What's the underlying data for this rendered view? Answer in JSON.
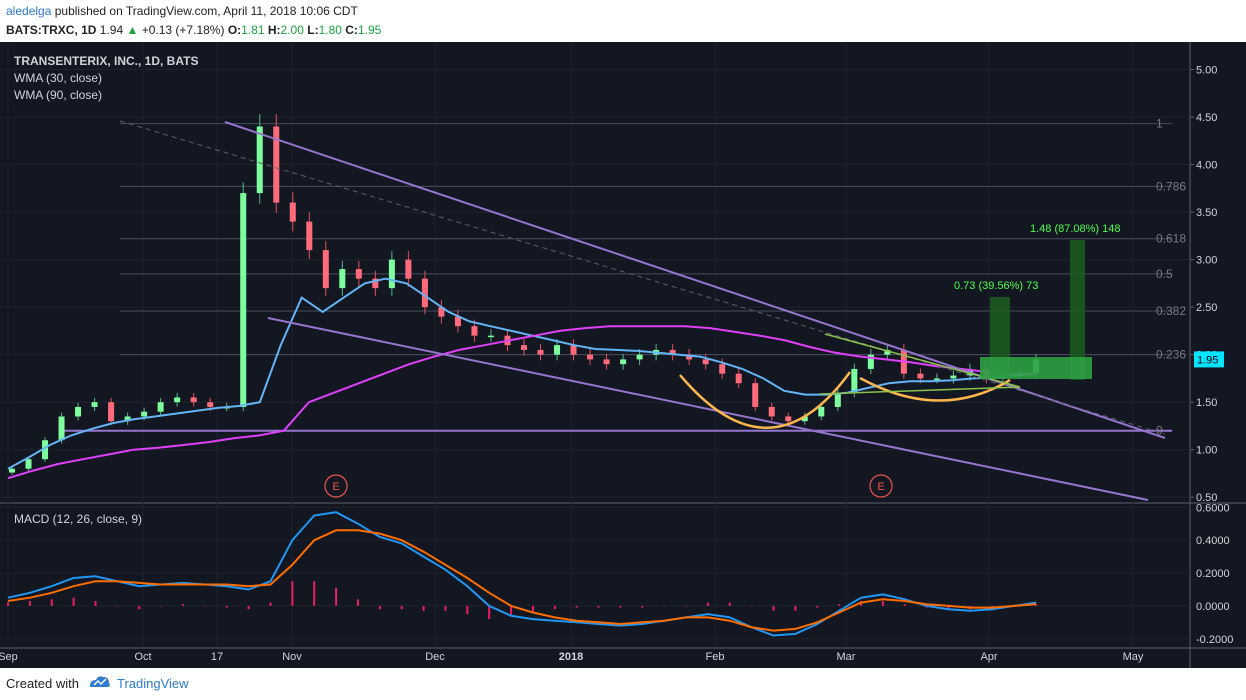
{
  "header": {
    "user": "aledelga",
    "published": "published on TradingView.com, April 11, 2018 10:06 CDT",
    "symbol": "BATS:TRXC, 1D",
    "last": "1.94",
    "change": "+0.13 (+7.18%)",
    "o_label": "O:",
    "o": "1.81",
    "h_label": "H:",
    "h": "2.00",
    "l_label": "L:",
    "l": "1.80",
    "c_label": "C:",
    "c": "1.95"
  },
  "legend": {
    "title": "TRANSENTERIX, INC., 1D, BATS",
    "wma30": "WMA (30, close)",
    "wma90": "WMA (90, close)",
    "macd": "MACD (12, 26, close, 9)"
  },
  "footer": {
    "created": "Created with",
    "brand": "TradingView"
  },
  "chart_data": [
    {
      "type": "candlestick",
      "title": "TRANSENTERIX, INC., 1D, BATS",
      "x_ticks": [
        "Sep",
        "Oct",
        "17",
        "Nov",
        "Dec",
        "2018",
        "Feb",
        "Mar",
        "Apr",
        "May"
      ],
      "y_ticks": [
        "5.00",
        "4.50",
        "4.00",
        "3.50",
        "3.00",
        "2.50",
        "2.00",
        "1.50",
        "1.00",
        "0.50"
      ],
      "ylim": [
        0.45,
        5.1
      ],
      "last_price_label": "1.95",
      "close_path": [
        0.8,
        0.9,
        1.1,
        1.35,
        1.45,
        1.5,
        1.3,
        1.35,
        1.4,
        1.5,
        1.55,
        1.5,
        1.45,
        1.45,
        3.7,
        4.4,
        3.6,
        3.4,
        3.1,
        2.7,
        2.9,
        2.8,
        2.7,
        3.0,
        2.8,
        2.5,
        2.4,
        2.3,
        2.2,
        2.2,
        2.1,
        2.05,
        2.0,
        2.1,
        2.0,
        1.95,
        1.9,
        1.95,
        2.0,
        2.05,
        2.0,
        1.95,
        1.9,
        1.8,
        1.7,
        1.45,
        1.35,
        1.3,
        1.35,
        1.45,
        1.6,
        1.85,
        2.0,
        2.05,
        1.8,
        1.75,
        1.75,
        1.78,
        1.85,
        1.75,
        1.8,
        1.81,
        1.95
      ],
      "wma30": [
        0.8,
        0.92,
        1.05,
        1.15,
        1.22,
        1.28,
        1.32,
        1.35,
        1.38,
        1.41,
        1.44,
        1.46,
        1.5,
        2.1,
        2.6,
        2.45,
        2.6,
        2.75,
        2.8,
        2.75,
        2.6,
        2.45,
        2.35,
        2.3,
        2.25,
        2.2,
        2.15,
        2.1,
        2.06,
        2.05,
        2.04,
        2.02,
        2.0,
        1.98,
        1.92,
        1.85,
        1.75,
        1.62,
        1.58,
        1.58,
        1.6,
        1.65,
        1.7,
        1.72,
        1.72,
        1.73,
        1.75,
        1.76,
        1.78,
        1.8
      ],
      "wma90": [
        0.7,
        0.78,
        0.85,
        0.9,
        0.95,
        1.0,
        1.02,
        1.05,
        1.08,
        1.12,
        1.15,
        1.2,
        1.5,
        1.6,
        1.7,
        1.8,
        1.9,
        1.98,
        2.05,
        2.1,
        2.15,
        2.2,
        2.25,
        2.28,
        2.3,
        2.3,
        2.3,
        2.3,
        2.28,
        2.24,
        2.2,
        2.15,
        2.08,
        2.02,
        1.98,
        1.95,
        1.92,
        1.88,
        1.85,
        1.82,
        1.8,
        1.8
      ],
      "fib_levels": [
        {
          "label": "1",
          "value": 4.43
        },
        {
          "label": "0.786",
          "value": 3.77
        },
        {
          "label": "0.618",
          "value": 3.22
        },
        {
          "label": "0.5",
          "value": 2.85
        },
        {
          "label": "0.382",
          "value": 2.46
        },
        {
          "label": "0.236",
          "value": 2.0
        },
        {
          "label": "0",
          "value": 1.2
        }
      ],
      "annotations": [
        {
          "text": "1.48 (87.08%) 148",
          "color": "#4cff4c"
        },
        {
          "text": "0.73 (39.56%) 73",
          "color": "#4cff4c"
        },
        {
          "text": "E"
        },
        {
          "text": "E"
        }
      ]
    },
    {
      "type": "line",
      "title": "MACD (12, 26, close, 9)",
      "y_ticks": [
        "0.6000",
        "0.4000",
        "0.2000",
        "0.0000",
        "-0.2000"
      ],
      "ylim": [
        -0.25,
        0.62
      ],
      "macd": [
        0.05,
        0.08,
        0.12,
        0.17,
        0.18,
        0.15,
        0.12,
        0.13,
        0.14,
        0.13,
        0.12,
        0.1,
        0.15,
        0.4,
        0.55,
        0.57,
        0.5,
        0.42,
        0.38,
        0.3,
        0.22,
        0.12,
        0.0,
        -0.06,
        -0.08,
        -0.09,
        -0.1,
        -0.11,
        -0.12,
        -0.11,
        -0.09,
        -0.07,
        -0.05,
        -0.07,
        -0.13,
        -0.18,
        -0.17,
        -0.11,
        -0.03,
        0.05,
        0.07,
        0.04,
        0.0,
        -0.02,
        -0.03,
        -0.02,
        0.0,
        0.02
      ],
      "signal": [
        0.03,
        0.05,
        0.08,
        0.12,
        0.15,
        0.15,
        0.14,
        0.13,
        0.13,
        0.13,
        0.13,
        0.12,
        0.13,
        0.25,
        0.4,
        0.46,
        0.46,
        0.44,
        0.4,
        0.33,
        0.25,
        0.17,
        0.08,
        0.0,
        -0.04,
        -0.07,
        -0.09,
        -0.1,
        -0.11,
        -0.1,
        -0.09,
        -0.07,
        -0.07,
        -0.09,
        -0.13,
        -0.15,
        -0.14,
        -0.1,
        -0.04,
        0.02,
        0.04,
        0.03,
        0.01,
        0.0,
        -0.01,
        -0.01,
        0.0,
        0.01
      ]
    }
  ]
}
